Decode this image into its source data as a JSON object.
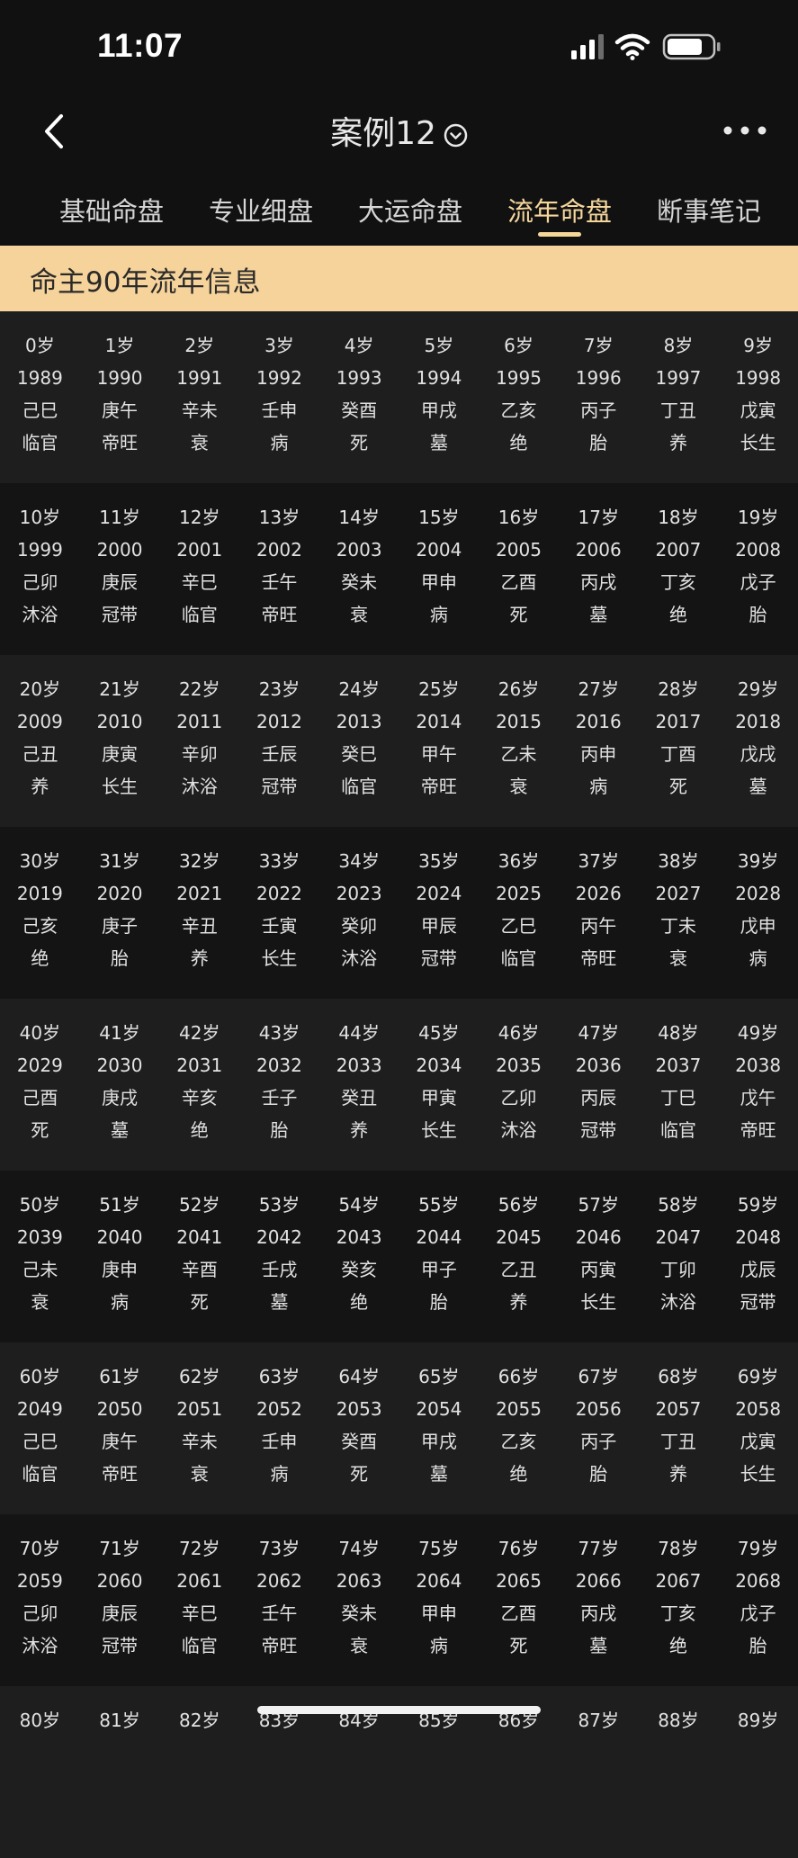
{
  "status_bar": {
    "time": "11:07"
  },
  "nav": {
    "title": "案例12"
  },
  "tabs": [
    {
      "label": "基础命盘",
      "active": false
    },
    {
      "label": "专业细盘",
      "active": false
    },
    {
      "label": "大运命盘",
      "active": false
    },
    {
      "label": "流年命盘",
      "active": true
    },
    {
      "label": "断事笔记",
      "active": false
    }
  ],
  "banner": {
    "title": "命主90年流年信息"
  },
  "colors": {
    "accent": "#f5d79c",
    "banner_bg": "#f6d39a",
    "background": "#111111"
  },
  "rows": [
    {
      "cells": [
        {
          "age": "0岁",
          "year": "1989",
          "ganzhi": "己巳",
          "stage": "临官"
        },
        {
          "age": "1岁",
          "year": "1990",
          "ganzhi": "庚午",
          "stage": "帝旺"
        },
        {
          "age": "2岁",
          "year": "1991",
          "ganzhi": "辛未",
          "stage": "衰"
        },
        {
          "age": "3岁",
          "year": "1992",
          "ganzhi": "壬申",
          "stage": "病"
        },
        {
          "age": "4岁",
          "year": "1993",
          "ganzhi": "癸酉",
          "stage": "死"
        },
        {
          "age": "5岁",
          "year": "1994",
          "ganzhi": "甲戌",
          "stage": "墓"
        },
        {
          "age": "6岁",
          "year": "1995",
          "ganzhi": "乙亥",
          "stage": "绝"
        },
        {
          "age": "7岁",
          "year": "1996",
          "ganzhi": "丙子",
          "stage": "胎"
        },
        {
          "age": "8岁",
          "year": "1997",
          "ganzhi": "丁丑",
          "stage": "养"
        },
        {
          "age": "9岁",
          "year": "1998",
          "ganzhi": "戊寅",
          "stage": "长生"
        }
      ]
    },
    {
      "cells": [
        {
          "age": "10岁",
          "year": "1999",
          "ganzhi": "己卯",
          "stage": "沐浴"
        },
        {
          "age": "11岁",
          "year": "2000",
          "ganzhi": "庚辰",
          "stage": "冠带"
        },
        {
          "age": "12岁",
          "year": "2001",
          "ganzhi": "辛巳",
          "stage": "临官"
        },
        {
          "age": "13岁",
          "year": "2002",
          "ganzhi": "壬午",
          "stage": "帝旺"
        },
        {
          "age": "14岁",
          "year": "2003",
          "ganzhi": "癸未",
          "stage": "衰"
        },
        {
          "age": "15岁",
          "year": "2004",
          "ganzhi": "甲申",
          "stage": "病"
        },
        {
          "age": "16岁",
          "year": "2005",
          "ganzhi": "乙酉",
          "stage": "死"
        },
        {
          "age": "17岁",
          "year": "2006",
          "ganzhi": "丙戌",
          "stage": "墓"
        },
        {
          "age": "18岁",
          "year": "2007",
          "ganzhi": "丁亥",
          "stage": "绝"
        },
        {
          "age": "19岁",
          "year": "2008",
          "ganzhi": "戊子",
          "stage": "胎"
        }
      ]
    },
    {
      "cells": [
        {
          "age": "20岁",
          "year": "2009",
          "ganzhi": "己丑",
          "stage": "养"
        },
        {
          "age": "21岁",
          "year": "2010",
          "ganzhi": "庚寅",
          "stage": "长生"
        },
        {
          "age": "22岁",
          "year": "2011",
          "ganzhi": "辛卯",
          "stage": "沐浴"
        },
        {
          "age": "23岁",
          "year": "2012",
          "ganzhi": "壬辰",
          "stage": "冠带"
        },
        {
          "age": "24岁",
          "year": "2013",
          "ganzhi": "癸巳",
          "stage": "临官"
        },
        {
          "age": "25岁",
          "year": "2014",
          "ganzhi": "甲午",
          "stage": "帝旺"
        },
        {
          "age": "26岁",
          "year": "2015",
          "ganzhi": "乙未",
          "stage": "衰"
        },
        {
          "age": "27岁",
          "year": "2016",
          "ganzhi": "丙申",
          "stage": "病"
        },
        {
          "age": "28岁",
          "year": "2017",
          "ganzhi": "丁酉",
          "stage": "死"
        },
        {
          "age": "29岁",
          "year": "2018",
          "ganzhi": "戊戌",
          "stage": "墓"
        }
      ]
    },
    {
      "cells": [
        {
          "age": "30岁",
          "year": "2019",
          "ganzhi": "己亥",
          "stage": "绝"
        },
        {
          "age": "31岁",
          "year": "2020",
          "ganzhi": "庚子",
          "stage": "胎"
        },
        {
          "age": "32岁",
          "year": "2021",
          "ganzhi": "辛丑",
          "stage": "养"
        },
        {
          "age": "33岁",
          "year": "2022",
          "ganzhi": "壬寅",
          "stage": "长生"
        },
        {
          "age": "34岁",
          "year": "2023",
          "ganzhi": "癸卯",
          "stage": "沐浴"
        },
        {
          "age": "35岁",
          "year": "2024",
          "ganzhi": "甲辰",
          "stage": "冠带"
        },
        {
          "age": "36岁",
          "year": "2025",
          "ganzhi": "乙巳",
          "stage": "临官"
        },
        {
          "age": "37岁",
          "year": "2026",
          "ganzhi": "丙午",
          "stage": "帝旺"
        },
        {
          "age": "38岁",
          "year": "2027",
          "ganzhi": "丁未",
          "stage": "衰"
        },
        {
          "age": "39岁",
          "year": "2028",
          "ganzhi": "戊申",
          "stage": "病"
        }
      ]
    },
    {
      "cells": [
        {
          "age": "40岁",
          "year": "2029",
          "ganzhi": "己酉",
          "stage": "死"
        },
        {
          "age": "41岁",
          "year": "2030",
          "ganzhi": "庚戌",
          "stage": "墓"
        },
        {
          "age": "42岁",
          "year": "2031",
          "ganzhi": "辛亥",
          "stage": "绝"
        },
        {
          "age": "43岁",
          "year": "2032",
          "ganzhi": "壬子",
          "stage": "胎"
        },
        {
          "age": "44岁",
          "year": "2033",
          "ganzhi": "癸丑",
          "stage": "养"
        },
        {
          "age": "45岁",
          "year": "2034",
          "ganzhi": "甲寅",
          "stage": "长生"
        },
        {
          "age": "46岁",
          "year": "2035",
          "ganzhi": "乙卯",
          "stage": "沐浴"
        },
        {
          "age": "47岁",
          "year": "2036",
          "ganzhi": "丙辰",
          "stage": "冠带"
        },
        {
          "age": "48岁",
          "year": "2037",
          "ganzhi": "丁巳",
          "stage": "临官"
        },
        {
          "age": "49岁",
          "year": "2038",
          "ganzhi": "戊午",
          "stage": "帝旺"
        }
      ]
    },
    {
      "cells": [
        {
          "age": "50岁",
          "year": "2039",
          "ganzhi": "己未",
          "stage": "衰"
        },
        {
          "age": "51岁",
          "year": "2040",
          "ganzhi": "庚申",
          "stage": "病"
        },
        {
          "age": "52岁",
          "year": "2041",
          "ganzhi": "辛酉",
          "stage": "死"
        },
        {
          "age": "53岁",
          "year": "2042",
          "ganzhi": "壬戌",
          "stage": "墓"
        },
        {
          "age": "54岁",
          "year": "2043",
          "ganzhi": "癸亥",
          "stage": "绝"
        },
        {
          "age": "55岁",
          "year": "2044",
          "ganzhi": "甲子",
          "stage": "胎"
        },
        {
          "age": "56岁",
          "year": "2045",
          "ganzhi": "乙丑",
          "stage": "养"
        },
        {
          "age": "57岁",
          "year": "2046",
          "ganzhi": "丙寅",
          "stage": "长生"
        },
        {
          "age": "58岁",
          "year": "2047",
          "ganzhi": "丁卯",
          "stage": "沐浴"
        },
        {
          "age": "59岁",
          "year": "2048",
          "ganzhi": "戊辰",
          "stage": "冠带"
        }
      ]
    },
    {
      "cells": [
        {
          "age": "60岁",
          "year": "2049",
          "ganzhi": "己巳",
          "stage": "临官"
        },
        {
          "age": "61岁",
          "year": "2050",
          "ganzhi": "庚午",
          "stage": "帝旺"
        },
        {
          "age": "62岁",
          "year": "2051",
          "ganzhi": "辛未",
          "stage": "衰"
        },
        {
          "age": "63岁",
          "year": "2052",
          "ganzhi": "壬申",
          "stage": "病"
        },
        {
          "age": "64岁",
          "year": "2053",
          "ganzhi": "癸酉",
          "stage": "死"
        },
        {
          "age": "65岁",
          "year": "2054",
          "ganzhi": "甲戌",
          "stage": "墓"
        },
        {
          "age": "66岁",
          "year": "2055",
          "ganzhi": "乙亥",
          "stage": "绝"
        },
        {
          "age": "67岁",
          "year": "2056",
          "ganzhi": "丙子",
          "stage": "胎"
        },
        {
          "age": "68岁",
          "year": "2057",
          "ganzhi": "丁丑",
          "stage": "养"
        },
        {
          "age": "69岁",
          "year": "2058",
          "ganzhi": "戊寅",
          "stage": "长生"
        }
      ]
    },
    {
      "cells": [
        {
          "age": "70岁",
          "year": "2059",
          "ganzhi": "己卯",
          "stage": "沐浴"
        },
        {
          "age": "71岁",
          "year": "2060",
          "ganzhi": "庚辰",
          "stage": "冠带"
        },
        {
          "age": "72岁",
          "year": "2061",
          "ganzhi": "辛巳",
          "stage": "临官"
        },
        {
          "age": "73岁",
          "year": "2062",
          "ganzhi": "壬午",
          "stage": "帝旺"
        },
        {
          "age": "74岁",
          "year": "2063",
          "ganzhi": "癸未",
          "stage": "衰"
        },
        {
          "age": "75岁",
          "year": "2064",
          "ganzhi": "甲申",
          "stage": "病"
        },
        {
          "age": "76岁",
          "year": "2065",
          "ganzhi": "乙酉",
          "stage": "死"
        },
        {
          "age": "77岁",
          "year": "2066",
          "ganzhi": "丙戌",
          "stage": "墓"
        },
        {
          "age": "78岁",
          "year": "2067",
          "ganzhi": "丁亥",
          "stage": "绝"
        },
        {
          "age": "79岁",
          "year": "2068",
          "ganzhi": "戊子",
          "stage": "胎"
        }
      ]
    },
    {
      "cells": [
        {
          "age": "80岁"
        },
        {
          "age": "81岁"
        },
        {
          "age": "82岁"
        },
        {
          "age": "83岁"
        },
        {
          "age": "84岁"
        },
        {
          "age": "85岁"
        },
        {
          "age": "86岁"
        },
        {
          "age": "87岁"
        },
        {
          "age": "88岁"
        },
        {
          "age": "89岁"
        }
      ]
    }
  ]
}
